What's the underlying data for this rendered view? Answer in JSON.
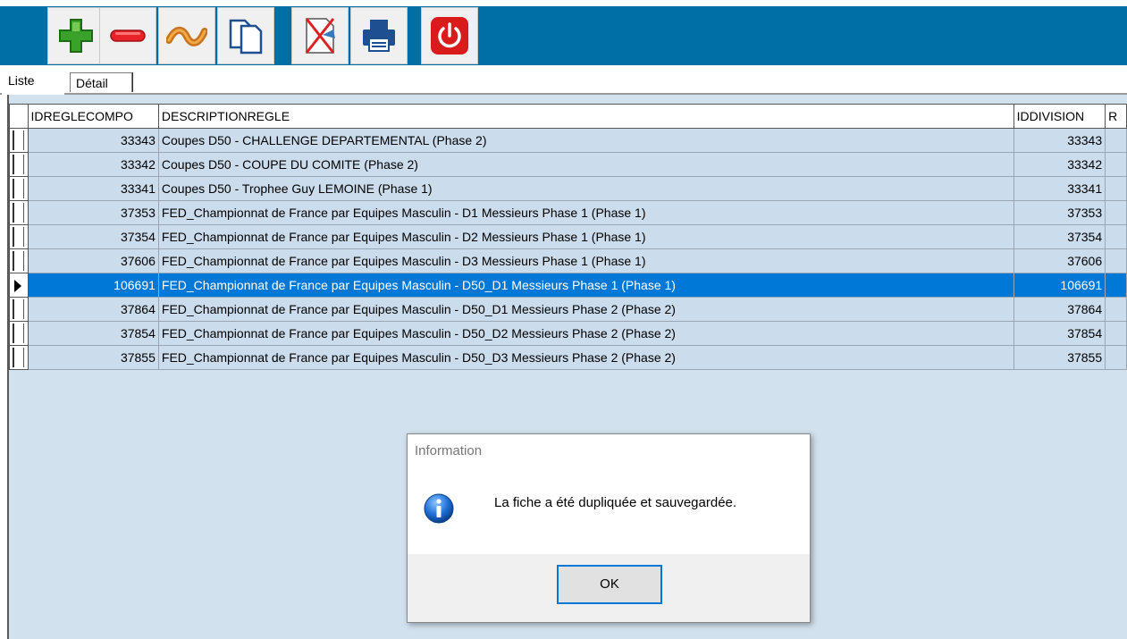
{
  "toolbar": {
    "background": "#006fa6",
    "buttons": [
      {
        "name": "add",
        "icon": "plus-icon"
      },
      {
        "name": "delete",
        "icon": "minus-icon"
      },
      {
        "name": "modify",
        "icon": "wave-icon"
      },
      {
        "name": "duplicate",
        "icon": "copy-icon"
      },
      {
        "name": "cancel",
        "icon": "cancel-edit-icon"
      },
      {
        "name": "print",
        "icon": "printer-icon"
      },
      {
        "name": "quit",
        "icon": "power-icon"
      }
    ]
  },
  "tabs": {
    "liste": "Liste",
    "detail": "Détail"
  },
  "grid": {
    "columns": [
      "IDREGLECOMPO",
      "DESCRIPTIONREGLE",
      "IDDIVISION",
      "R"
    ],
    "rows": [
      {
        "id": "33343",
        "desc": "Coupes D50 - CHALLENGE DEPARTEMENTAL (Phase 2)",
        "division": "33343"
      },
      {
        "id": "33342",
        "desc": "Coupes D50 - COUPE DU COMITE (Phase 2)",
        "division": "33342"
      },
      {
        "id": "33341",
        "desc": "Coupes D50 - Trophee Guy LEMOINE (Phase 1)",
        "division": "33341"
      },
      {
        "id": "37353",
        "desc": "FED_Championnat de France par Equipes Masculin - D1 Messieurs Phase 1 (Phase 1)",
        "division": "37353"
      },
      {
        "id": "37354",
        "desc": "FED_Championnat de France par Equipes Masculin - D2 Messieurs Phase 1 (Phase 1)",
        "division": "37354"
      },
      {
        "id": "37606",
        "desc": "FED_Championnat de France par Equipes Masculin - D3 Messieurs Phase 1 (Phase 1)",
        "division": "37606"
      },
      {
        "id": "106691",
        "desc": "FED_Championnat de France par Equipes Masculin - D50_D1 Messieurs Phase 1 (Phase 1)",
        "division": "106691"
      },
      {
        "id": "37864",
        "desc": "FED_Championnat de France par Equipes Masculin - D50_D1 Messieurs Phase 2 (Phase 2)",
        "division": "37864"
      },
      {
        "id": "37854",
        "desc": "FED_Championnat de France par Equipes Masculin - D50_D2 Messieurs Phase 2 (Phase 2)",
        "division": "37854"
      },
      {
        "id": "37855",
        "desc": "FED_Championnat de France par Equipes Masculin - D50_D3 Messieurs Phase 2 (Phase 2)",
        "division": "37855"
      }
    ],
    "selected_color": "#0078d7"
  },
  "dialog": {
    "title": "Information",
    "message": "La fiche a été dupliquée et sauvegardée.",
    "ok_label": "OK",
    "icon": "info-icon"
  }
}
